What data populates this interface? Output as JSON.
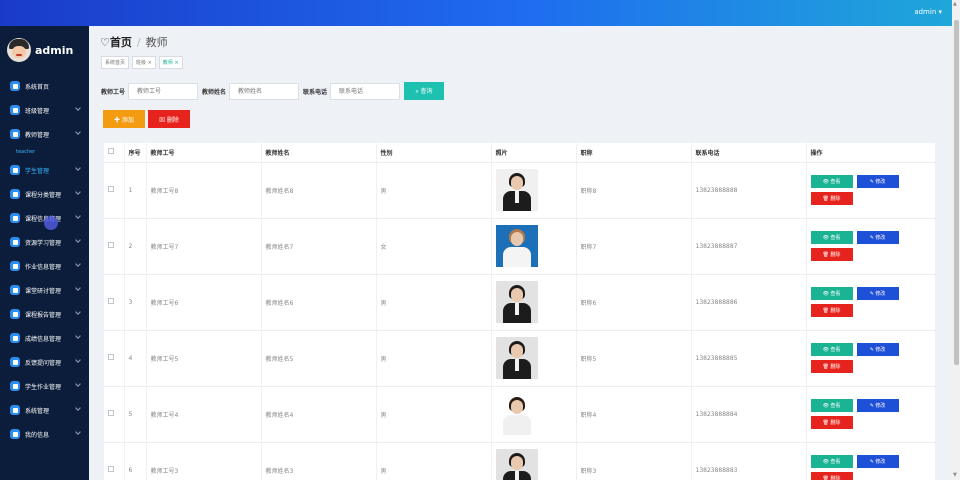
{
  "topbar": {
    "user_label": "admin ▾"
  },
  "sidebar": {
    "username": "admin",
    "items": [
      {
        "label": "系统首页",
        "arrow": false,
        "active": false
      },
      {
        "label": "班级管理",
        "arrow": true,
        "active": false
      },
      {
        "label": "教师管理",
        "arrow": true,
        "active": false
      },
      {
        "label": "teacher",
        "arrow": false,
        "active": true,
        "sub": true
      },
      {
        "label": "学生管理",
        "arrow": true,
        "active": true
      },
      {
        "label": "课程分类管理",
        "arrow": true,
        "active": false
      },
      {
        "label": "课程信息管理",
        "arrow": true,
        "active": false
      },
      {
        "label": "资源学习管理",
        "arrow": true,
        "active": false
      },
      {
        "label": "作业信息管理",
        "arrow": true,
        "active": false
      },
      {
        "label": "课堂研讨管理",
        "arrow": true,
        "active": false
      },
      {
        "label": "课程报告管理",
        "arrow": true,
        "active": false
      },
      {
        "label": "成绩信息管理",
        "arrow": true,
        "active": false
      },
      {
        "label": "反馈提问管理",
        "arrow": true,
        "active": false
      },
      {
        "label": "学生作业管理",
        "arrow": true,
        "active": false
      },
      {
        "label": "系统管理",
        "arrow": true,
        "active": false
      },
      {
        "label": "我的信息",
        "arrow": true,
        "active": false
      }
    ]
  },
  "header": {
    "home_label": "♡首页",
    "separator": "/",
    "page_label": "教师"
  },
  "tags": [
    {
      "label": "系统首页",
      "current": false
    },
    {
      "label": "班级 ×",
      "current": false
    },
    {
      "label": "教师 ×",
      "current": true
    }
  ],
  "search": {
    "fields": [
      {
        "label": "教师工号",
        "placeholder": "教师工号"
      },
      {
        "label": "教师姓名",
        "placeholder": "教师姓名"
      },
      {
        "label": "联系电话",
        "placeholder": "联系电话"
      }
    ],
    "button_label": "⌕ 查询"
  },
  "actions": {
    "add_label": "✚ 添加",
    "delete_label": "⊠ 删除"
  },
  "table": {
    "columns": [
      "",
      "序号",
      "教师工号",
      "教师姓名",
      "性别",
      "照片",
      "职称",
      "联系电话",
      "操作"
    ],
    "rows": [
      {
        "index": "1",
        "id": "教师工号8",
        "name": "教师姓名8",
        "gender": "男",
        "photo": "male-suit",
        "title": "职称8",
        "phone": "13823888888"
      },
      {
        "index": "2",
        "id": "教师工号7",
        "name": "教师姓名7",
        "gender": "女",
        "photo": "female-blue",
        "title": "职称7",
        "phone": "13823888887"
      },
      {
        "index": "3",
        "id": "教师工号6",
        "name": "教师姓名6",
        "gender": "男",
        "photo": "female-suit",
        "title": "职称6",
        "phone": "13823888886"
      },
      {
        "index": "4",
        "id": "教师工号5",
        "name": "教师姓名5",
        "gender": "男",
        "photo": "female-suit",
        "title": "职称5",
        "phone": "13823888885"
      },
      {
        "index": "5",
        "id": "教师工号4",
        "name": "教师姓名4",
        "gender": "男",
        "photo": "female-white",
        "title": "职称4",
        "phone": "13823888884"
      },
      {
        "index": "6",
        "id": "教师工号3",
        "name": "教师姓名3",
        "gender": "男",
        "photo": "female-suit",
        "title": "职称3",
        "phone": "13823888883"
      }
    ],
    "op_labels": {
      "view": "👁 查看",
      "edit": "✎ 修改",
      "delete": "🗑 删除"
    }
  },
  "colors": {
    "accent": "#1ab394",
    "primary": "#1e4fd7",
    "danger": "#e7231e",
    "warning": "#f39c12",
    "sidebar_bg": "#0b1d3a"
  }
}
